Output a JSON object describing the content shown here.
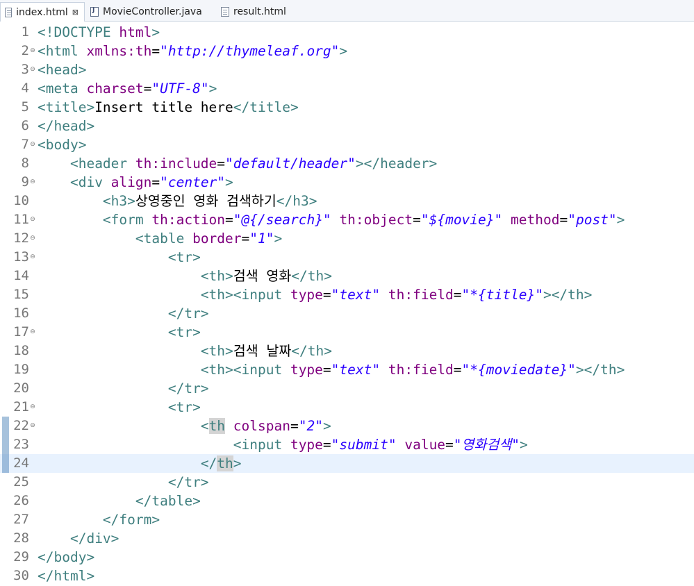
{
  "tabs": [
    {
      "label": "index.html",
      "icon": "html-file-icon",
      "active": true,
      "close": "⊠"
    },
    {
      "label": "MovieController.java",
      "icon": "java-file-icon",
      "active": false
    },
    {
      "label": "result.html",
      "icon": "html-file-icon",
      "active": false
    }
  ],
  "editor": {
    "current_line": 24,
    "lines": [
      {
        "n": "1",
        "fold": false,
        "segs": [
          [
            "t",
            "<!DOCTYPE "
          ],
          [
            "a",
            "html"
          ],
          [
            "t",
            ">"
          ]
        ]
      },
      {
        "n": "2",
        "fold": true,
        "segs": [
          [
            "t",
            "<html "
          ],
          [
            "a",
            "xmlns:th"
          ],
          [
            "p",
            "="
          ],
          [
            "v",
            "\"http://thymeleaf.org\""
          ],
          [
            "t",
            ">"
          ]
        ]
      },
      {
        "n": "3",
        "fold": true,
        "segs": [
          [
            "t",
            "<head>"
          ]
        ]
      },
      {
        "n": "4",
        "fold": false,
        "segs": [
          [
            "t",
            "<meta "
          ],
          [
            "a",
            "charset"
          ],
          [
            "p",
            "="
          ],
          [
            "v",
            "\"UTF-8\""
          ],
          [
            "t",
            ">"
          ]
        ]
      },
      {
        "n": "5",
        "fold": false,
        "segs": [
          [
            "t",
            "<title>"
          ],
          [
            "p",
            "Insert title here"
          ],
          [
            "t",
            "</title>"
          ]
        ]
      },
      {
        "n": "6",
        "fold": false,
        "segs": [
          [
            "t",
            "</head>"
          ]
        ]
      },
      {
        "n": "7",
        "fold": true,
        "segs": [
          [
            "t",
            "<body>"
          ]
        ]
      },
      {
        "n": "8",
        "fold": false,
        "segs": [
          [
            "p",
            "    "
          ],
          [
            "t",
            "<header "
          ],
          [
            "a",
            "th:include"
          ],
          [
            "p",
            "="
          ],
          [
            "v",
            "\"default/header\""
          ],
          [
            "t",
            "></header>"
          ]
        ]
      },
      {
        "n": "9",
        "fold": true,
        "segs": [
          [
            "p",
            "    "
          ],
          [
            "t",
            "<div "
          ],
          [
            "a",
            "align"
          ],
          [
            "p",
            "="
          ],
          [
            "v",
            "\"center\""
          ],
          [
            "t",
            ">"
          ]
        ]
      },
      {
        "n": "10",
        "fold": false,
        "segs": [
          [
            "p",
            "        "
          ],
          [
            "t",
            "<h3>"
          ],
          [
            "p",
            "상영중인 영화 검색하기"
          ],
          [
            "t",
            "</h3>"
          ]
        ]
      },
      {
        "n": "11",
        "fold": true,
        "segs": [
          [
            "p",
            "        "
          ],
          [
            "t",
            "<form "
          ],
          [
            "a",
            "th:action"
          ],
          [
            "p",
            "="
          ],
          [
            "v",
            "\"@{/search}\""
          ],
          [
            "p",
            " "
          ],
          [
            "a",
            "th:object"
          ],
          [
            "p",
            "="
          ],
          [
            "v",
            "\"${movie}\""
          ],
          [
            "p",
            " "
          ],
          [
            "a",
            "method"
          ],
          [
            "p",
            "="
          ],
          [
            "v",
            "\"post\""
          ],
          [
            "t",
            ">"
          ]
        ]
      },
      {
        "n": "12",
        "fold": true,
        "segs": [
          [
            "p",
            "            "
          ],
          [
            "t",
            "<table "
          ],
          [
            "a",
            "border"
          ],
          [
            "p",
            "="
          ],
          [
            "v",
            "\"1\""
          ],
          [
            "t",
            ">"
          ]
        ]
      },
      {
        "n": "13",
        "fold": true,
        "segs": [
          [
            "p",
            "                "
          ],
          [
            "t",
            "<tr>"
          ]
        ]
      },
      {
        "n": "14",
        "fold": false,
        "segs": [
          [
            "p",
            "                    "
          ],
          [
            "t",
            "<th>"
          ],
          [
            "p",
            "검색 영화"
          ],
          [
            "t",
            "</th>"
          ]
        ]
      },
      {
        "n": "15",
        "fold": false,
        "segs": [
          [
            "p",
            "                    "
          ],
          [
            "t",
            "<th><input "
          ],
          [
            "a",
            "type"
          ],
          [
            "p",
            "="
          ],
          [
            "v",
            "\"text\""
          ],
          [
            "p",
            " "
          ],
          [
            "a",
            "th:field"
          ],
          [
            "p",
            "="
          ],
          [
            "v",
            "\"*{title}\""
          ],
          [
            "t",
            "></th>"
          ]
        ]
      },
      {
        "n": "16",
        "fold": false,
        "segs": [
          [
            "p",
            "                "
          ],
          [
            "t",
            "</tr>"
          ]
        ]
      },
      {
        "n": "17",
        "fold": true,
        "segs": [
          [
            "p",
            "                "
          ],
          [
            "t",
            "<tr>"
          ]
        ]
      },
      {
        "n": "18",
        "fold": false,
        "segs": [
          [
            "p",
            "                    "
          ],
          [
            "t",
            "<th>"
          ],
          [
            "p",
            "검색 날짜"
          ],
          [
            "t",
            "</th>"
          ]
        ]
      },
      {
        "n": "19",
        "fold": false,
        "segs": [
          [
            "p",
            "                    "
          ],
          [
            "t",
            "<th><input "
          ],
          [
            "a",
            "type"
          ],
          [
            "p",
            "="
          ],
          [
            "v",
            "\"text\""
          ],
          [
            "p",
            " "
          ],
          [
            "a",
            "th:field"
          ],
          [
            "p",
            "="
          ],
          [
            "v",
            "\"*{moviedate}\""
          ],
          [
            "t",
            "></th>"
          ]
        ]
      },
      {
        "n": "20",
        "fold": false,
        "segs": [
          [
            "p",
            "                "
          ],
          [
            "t",
            "</tr>"
          ]
        ]
      },
      {
        "n": "21",
        "fold": true,
        "segs": [
          [
            "p",
            "                "
          ],
          [
            "t",
            "<tr>"
          ]
        ]
      },
      {
        "n": "22",
        "fold": true,
        "segs": [
          [
            "p",
            "                    "
          ],
          [
            "t",
            "<"
          ],
          [
            "th",
            "th"
          ],
          [
            "p",
            " "
          ],
          [
            "a",
            "colspan"
          ],
          [
            "p",
            "="
          ],
          [
            "v",
            "\"2\""
          ],
          [
            "t",
            ">"
          ]
        ]
      },
      {
        "n": "23",
        "fold": false,
        "segs": [
          [
            "p",
            "                        "
          ],
          [
            "t",
            "<input "
          ],
          [
            "a",
            "type"
          ],
          [
            "p",
            "="
          ],
          [
            "v",
            "\"submit\""
          ],
          [
            "p",
            " "
          ],
          [
            "a",
            "value"
          ],
          [
            "p",
            "="
          ],
          [
            "v",
            "\"영화검색\""
          ],
          [
            "t",
            ">"
          ]
        ]
      },
      {
        "n": "24",
        "fold": false,
        "segs": [
          [
            "p",
            "                    "
          ],
          [
            "t",
            "</"
          ],
          [
            "th",
            "th"
          ],
          [
            "t",
            ">"
          ]
        ]
      },
      {
        "n": "25",
        "fold": false,
        "segs": [
          [
            "p",
            "                "
          ],
          [
            "t",
            "</tr>"
          ]
        ]
      },
      {
        "n": "26",
        "fold": false,
        "segs": [
          [
            "p",
            "            "
          ],
          [
            "t",
            "</table>"
          ]
        ]
      },
      {
        "n": "27",
        "fold": false,
        "segs": [
          [
            "p",
            "        "
          ],
          [
            "t",
            "</form>"
          ]
        ]
      },
      {
        "n": "28",
        "fold": false,
        "segs": [
          [
            "p",
            "    "
          ],
          [
            "t",
            "</div>"
          ]
        ]
      },
      {
        "n": "29",
        "fold": false,
        "segs": [
          [
            "t",
            "</body>"
          ]
        ]
      },
      {
        "n": "30",
        "fold": false,
        "segs": [
          [
            "t",
            "</html>"
          ]
        ]
      }
    ]
  },
  "colors": {
    "tag": "#3f7f7f",
    "attr": "#7f007f",
    "value": "#2a00ff",
    "current_line": "#e8f2fe"
  }
}
